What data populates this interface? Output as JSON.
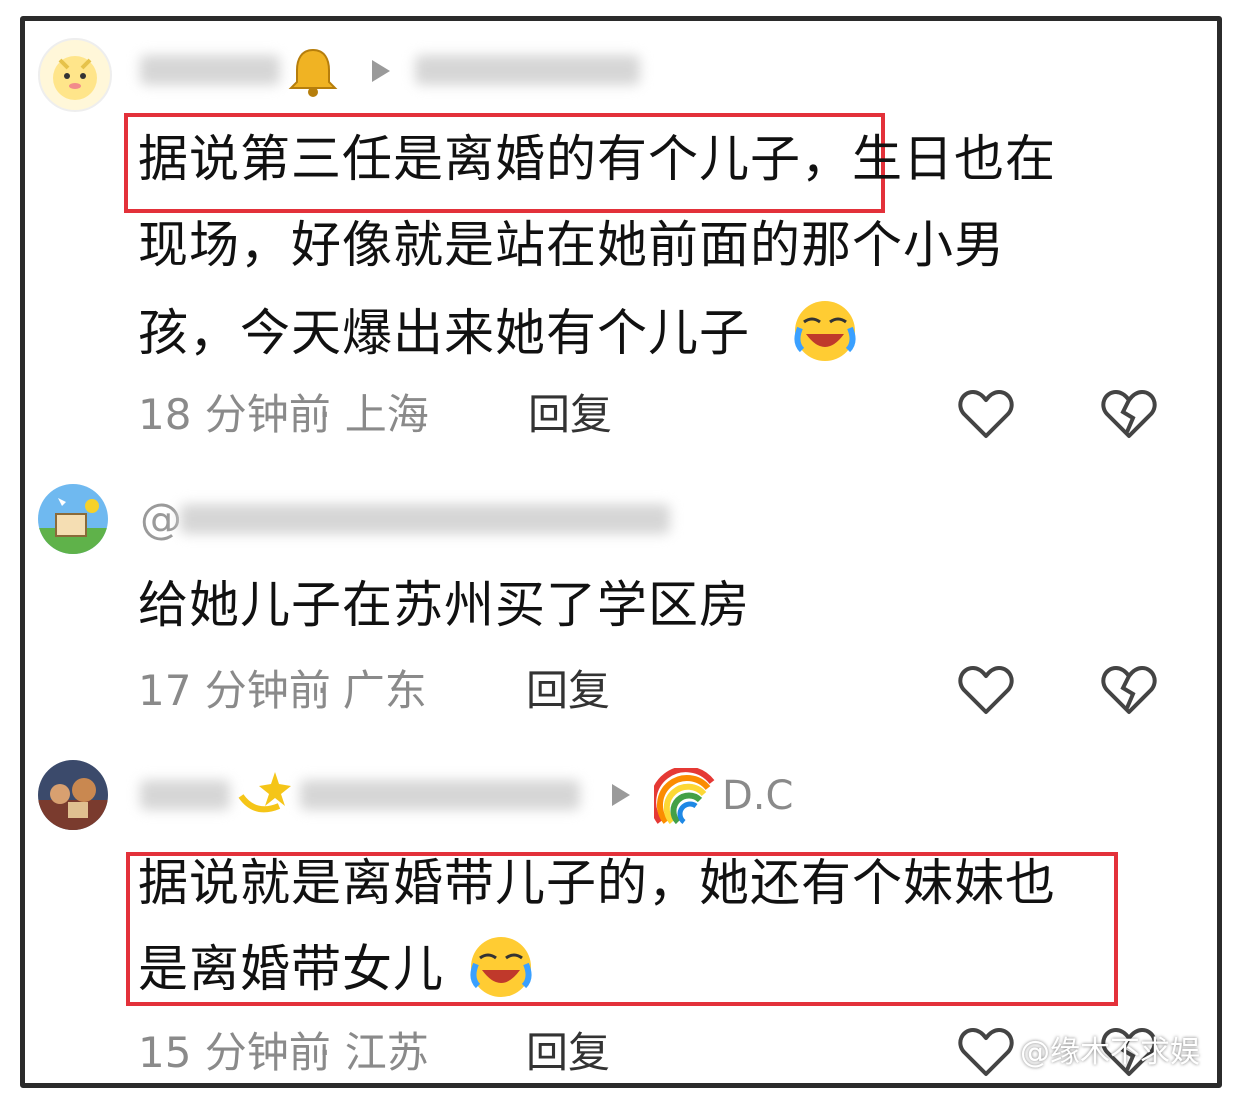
{
  "comments": [
    {
      "text_lines": [
        "据说第三任是离婚的有个儿子，生日也在",
        "现场，好像就是站在她前面的那个小男",
        "孩，今天爆出来她有个儿子"
      ],
      "time": "18 分钟前",
      "location": "· 上海",
      "reply": "回复",
      "highlighted": "据说第三任是离婚的有个儿子，"
    },
    {
      "handle_prefix": "@",
      "text_lines": [
        "给她儿子在苏州买了学区房"
      ],
      "time": "17 分钟前",
      "location": "· 广东",
      "reply": "回复"
    },
    {
      "name_suffix": "D.C",
      "text_lines": [
        "据说就是离婚带儿子的，她还有个妹妹也",
        "是离婚带女儿"
      ],
      "time": "15 分钟前",
      "location": "· 江苏",
      "reply": "回复"
    }
  ],
  "watermark": "@缘木不求娱",
  "colors": {
    "highlight": "#e3313a",
    "meta": "#8a8a8a",
    "text": "#111111"
  },
  "icons": [
    "heart-icon",
    "broken-heart-icon",
    "bell-icon",
    "laughing-crying-emoji",
    "sparkle-emoji",
    "rainbow-emoji"
  ]
}
